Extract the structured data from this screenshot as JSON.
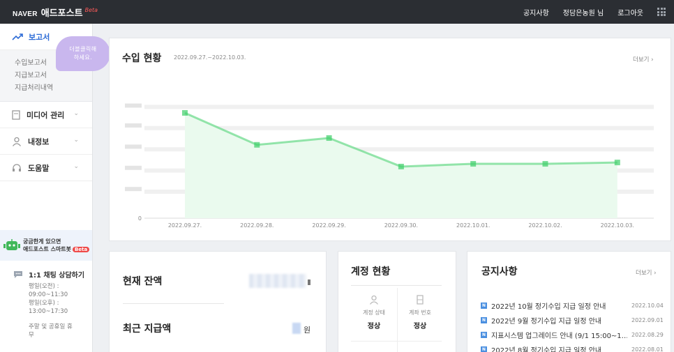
{
  "topbar": {
    "logo": "NAVER",
    "service": "애드포스트",
    "beta": "Beta",
    "links": [
      "공지사항",
      "정담은농원 님",
      "로그아웃"
    ]
  },
  "sidebar": {
    "active": "보고서",
    "submenu": [
      "수입보고서",
      "지급보고서",
      "지급처리내역"
    ],
    "items": [
      {
        "label": "미디어 관리",
        "icon": "document-icon"
      },
      {
        "label": "내정보",
        "icon": "person-icon"
      },
      {
        "label": "도움말",
        "icon": "headset-icon"
      }
    ],
    "chatbot": {
      "line1": "궁금한게 있으면",
      "line2": "애드포스트 스마트봇",
      "badge": "Beta"
    },
    "chat": {
      "title": "1:1 채팅 상담하기",
      "lines": [
        "평일(오전) :",
        "09:00~11:30",
        "평일(오후) :",
        "13:00~17:30",
        "",
        "주말 및 공휴일 휴",
        "무"
      ]
    }
  },
  "bubble": {
    "line1": "더블클릭해",
    "line2": "하세요."
  },
  "income": {
    "title": "수입 현황",
    "range": "2022.09.27.~2022.10.03.",
    "more": "더보기"
  },
  "chart_data": {
    "type": "area",
    "x": [
      "2022.09.27.",
      "2022.09.28.",
      "2022.09.29.",
      "2022.09.30.",
      "2022.10.01.",
      "2022.10.02.",
      "2022.10.03."
    ],
    "y_tick_labels": [
      "0"
    ],
    "values": [
      155,
      108,
      118,
      76,
      80,
      80,
      82
    ],
    "ylim": [
      0,
      195
    ],
    "grid": true,
    "accent": "#3fcf6a",
    "fill": "#eafaee"
  },
  "balance": {
    "current": "현재 잔액",
    "recent": "최근 지급액",
    "won": "원"
  },
  "account": {
    "title": "계정 현황",
    "status_label": "계정 상태",
    "status_value": "정상",
    "account_label": "계좌 번호",
    "account_value": "정상"
  },
  "notice": {
    "title": "공지사항",
    "more": "더보기",
    "icon_letter": "N",
    "items": [
      {
        "text": "2022년 10월 정기수입 지급 일정 안내",
        "date": "2022.10.04"
      },
      {
        "text": "2022년 9월 정기수입 지급 일정 안내",
        "date": "2022.09.01"
      },
      {
        "text": "지표시스템 업그레이드 안내 (9/1 15:00~1…",
        "date": "2022.08.29"
      },
      {
        "text": "2022년 8월 정기수입 지급 일정 안내",
        "date": "2022.08.01"
      }
    ]
  }
}
